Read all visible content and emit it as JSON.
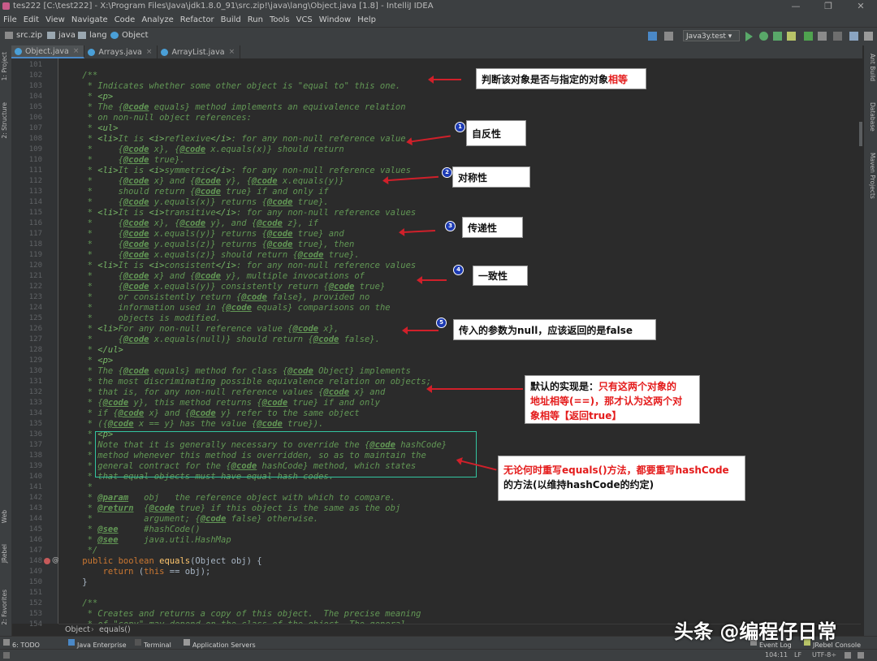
{
  "window": {
    "title": "tes222 [C:\\test222] - X:\\Program Files\\Java\\jdk1.8.0_91\\src.zip!\\java\\lang\\Object.java [1.8] - IntelliJ IDEA",
    "min": "—",
    "max": "❐",
    "close": "✕"
  },
  "menu": [
    "File",
    "Edit",
    "View",
    "Navigate",
    "Code",
    "Analyze",
    "Refactor",
    "Build",
    "Run",
    "Tools",
    "VCS",
    "Window",
    "Help"
  ],
  "breadcrumbs": [
    "src.zip",
    "java",
    "lang",
    "Object"
  ],
  "run_config": "Java3y.test ▾",
  "tabs": [
    {
      "label": "Object.java",
      "active": true
    },
    {
      "label": "Arrays.java",
      "active": false
    },
    {
      "label": "ArrayList.java",
      "active": false
    }
  ],
  "left_strip": [
    "1: Project",
    "2: Structure",
    "Web",
    "JRebel",
    "2: Favorites"
  ],
  "right_strip": [
    "Ant Build",
    "Database",
    "Maven Projects"
  ],
  "line_numbers": [
    "101",
    "102",
    "103",
    "104",
    "105",
    "106",
    "107",
    "108",
    "109",
    "110",
    "111",
    "112",
    "113",
    "114",
    "115",
    "116",
    "117",
    "118",
    "119",
    "120",
    "121",
    "122",
    "123",
    "124",
    "125",
    "126",
    "127",
    "128",
    "129",
    "130",
    "131",
    "132",
    "133",
    "134",
    "135",
    "136",
    "137",
    "138",
    "139",
    "140",
    "141",
    "142",
    "143",
    "144",
    "145",
    "146",
    "147",
    "148",
    "149",
    "150",
    "151",
    "152",
    "153",
    "154"
  ],
  "code_lines": [
    "",
    "    /**",
    "     * Indicates whether some other object is \"equal to\" this one.",
    "     * <p>",
    "     * The {@code equals} method implements an equivalence relation",
    "     * on non-null object references:",
    "     * <ul>",
    "     * <li>It is <i>reflexive</i>: for any non-null reference value",
    "     *     {@code x}, {@code x.equals(x)} should return",
    "     *     {@code true}.",
    "     * <li>It is <i>symmetric</i>: for any non-null reference values",
    "     *     {@code x} and {@code y}, {@code x.equals(y)}",
    "     *     should return {@code true} if and only if",
    "     *     {@code y.equals(x)} returns {@code true}.",
    "     * <li>It is <i>transitive</i>: for any non-null reference values",
    "     *     {@code x}, {@code y}, and {@code z}, if",
    "     *     {@code x.equals(y)} returns {@code true} and",
    "     *     {@code y.equals(z)} returns {@code true}, then",
    "     *     {@code x.equals(z)} should return {@code true}.",
    "     * <li>It is <i>consistent</i>: for any non-null reference values",
    "     *     {@code x} and {@code y}, multiple invocations of",
    "     *     {@code x.equals(y)} consistently return {@code true}",
    "     *     or consistently return {@code false}, provided no",
    "     *     information used in {@code equals} comparisons on the",
    "     *     objects is modified.",
    "     * <li>For any non-null reference value {@code x},",
    "     *     {@code x.equals(null)} should return {@code false}.",
    "     * </ul>",
    "     * <p>",
    "     * The {@code equals} method for class {@code Object} implements",
    "     * the most discriminating possible equivalence relation on objects;",
    "     * that is, for any non-null reference values {@code x} and",
    "     * {@code y}, this method returns {@code true} if and only",
    "     * if {@code x} and {@code y} refer to the same object",
    "     * ({@code x == y} has the value {@code true}).",
    "     * <p>",
    "     * Note that it is generally necessary to override the {@code hashCode}",
    "     * method whenever this method is overridden, so as to maintain the",
    "     * general contract for the {@code hashCode} method, which states",
    "     * that equal objects must have equal hash codes.",
    "     *",
    "     * @param   obj   the reference object with which to compare.",
    "     * @return  {@code true} if this object is the same as the obj",
    "     *          argument; {@code false} otherwise.",
    "     * @see     #hashCode()",
    "     * @see     java.util.HashMap",
    "     */",
    "    public boolean equals(Object obj) {",
    "        return (this == obj);",
    "    }",
    "",
    "    /**",
    "     * Creates and returns a copy of this object.  The precise meaning",
    "     * of \"copy\" may depend on the class of the object. The general"
  ],
  "annotations": {
    "a1_main": "判断该对象是否与指定的对象",
    "a1_red": "相等",
    "a2": "自反性",
    "a3": "对称性",
    "a4": "传递性",
    "a5": "一致性",
    "a6": "传入的参数为null，应该返回的是false",
    "a7_line1_main": "默认的实现是：",
    "a7_line1_red": "只有这两个对象的",
    "a7_line2": "地址相等(==)，那才认为这两个对",
    "a7_line3": "象相等【返回true】",
    "a8_line1": "无论何时重写equals()方法，都要重写hashCode",
    "a8_line2": "的方法(以维持hashCode的约定)",
    "badges": [
      "1",
      "2",
      "3",
      "4",
      "5"
    ]
  },
  "bottom_breadcrumb": [
    "Object",
    "equals()"
  ],
  "tool_windows": [
    "6: TODO",
    "Java Enterprise",
    "Terminal",
    "Application Servers",
    "Event Log",
    "JRebel Console"
  ],
  "status": {
    "position": "104:11",
    "line_sep": "LF",
    "encoding": "UTF-8÷"
  },
  "watermark": "头条 @编程仔日常",
  "colors": {
    "comment": "#629755",
    "keyword": "#cc7832",
    "accent_red": "#e41b1b",
    "badge_blue": "#1d3bb3",
    "highlight_box": "#33c5a0"
  }
}
